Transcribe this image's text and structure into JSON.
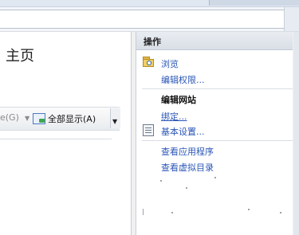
{
  "content": {
    "title": "主页",
    "toolbar": {
      "partial_label": "e(G)",
      "show_all_label": "全部显示(A)"
    }
  },
  "actions": {
    "header": "操作",
    "browse": "浏览",
    "edit_permissions": "编辑权限...",
    "section_title": "编辑网站",
    "bindings": "绑定...",
    "basic_settings": "基本设置...",
    "view_applications": "查看应用程序",
    "view_virtual_directories": "查看虚拟目录"
  },
  "colors": {
    "link": "#2a56b6",
    "header_bg": "#dde3ea"
  },
  "icons": {
    "browse": "folder-browse-icon",
    "basic_settings": "settings-form-icon",
    "show_all": "show-all-icon"
  }
}
